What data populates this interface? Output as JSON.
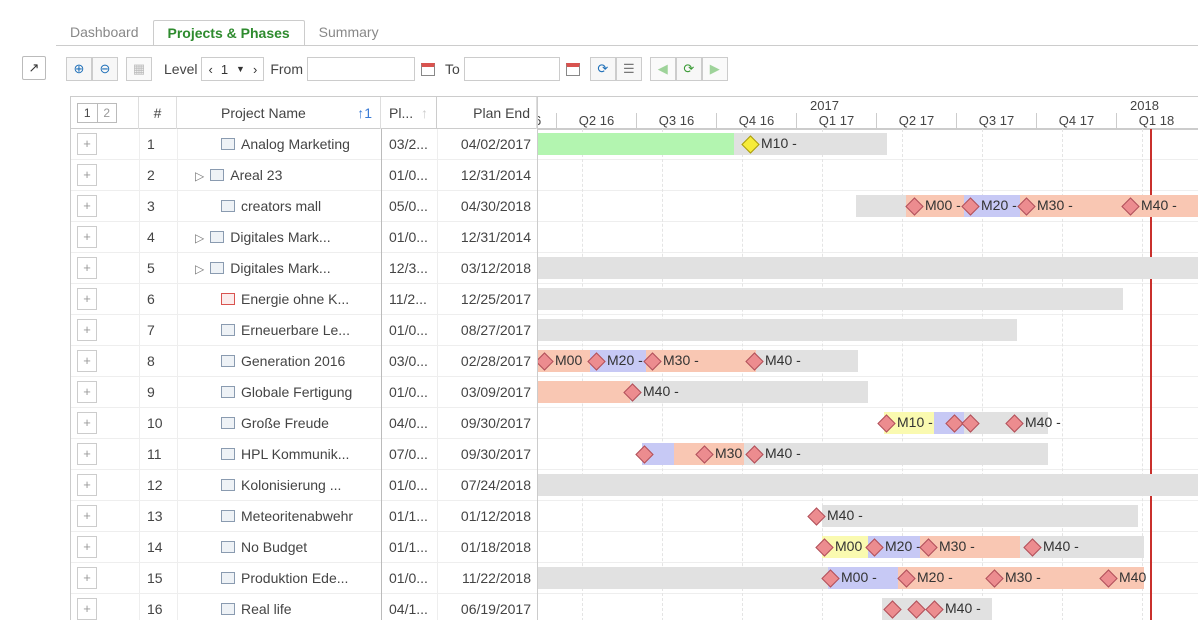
{
  "tabs": [
    "Dashboard",
    "Projects & Phases",
    "Summary"
  ],
  "toolbar": {
    "level_label": "Level",
    "level_value": "1",
    "from_label": "From",
    "to_label": "To",
    "from_value": "",
    "to_value": ""
  },
  "outline_levels": [
    "1",
    "2"
  ],
  "columns": {
    "num": "#",
    "name": "Project Name",
    "start": "Pl...",
    "end": "Plan End"
  },
  "timeline": {
    "years": [
      {
        "label": "2017"
      },
      {
        "label": "2018"
      }
    ],
    "quarters": [
      "Q2 16",
      "Q3 16",
      "Q4 16",
      "Q1 17",
      "Q2 17",
      "Q3 17",
      "Q4 17",
      "Q1 18"
    ],
    "partial_quarter": "6"
  },
  "rows": [
    {
      "num": "1",
      "name": "Analog Marketing",
      "start": "03/2...",
      "end": "04/02/2017",
      "expandable": false,
      "icon": "project-icon",
      "milestones_text": [
        "M10 -"
      ]
    },
    {
      "num": "2",
      "name": "Areal 23",
      "start": "01/0...",
      "end": "12/31/2014",
      "expandable": true,
      "icon": "project-icon",
      "milestones_text": []
    },
    {
      "num": "3",
      "name": "creators mall",
      "start": "05/0...",
      "end": "04/30/2018",
      "expandable": false,
      "icon": "project-icon",
      "milestones_text": [
        "M00 -",
        "M20 -",
        "M30 -",
        "M40 -"
      ]
    },
    {
      "num": "4",
      "name": "Digitales Mark...",
      "start": "01/0...",
      "end": "12/31/2014",
      "expandable": true,
      "icon": "project-icon",
      "milestones_text": []
    },
    {
      "num": "5",
      "name": "Digitales Mark...",
      "start": "12/3...",
      "end": "03/12/2018",
      "expandable": true,
      "icon": "project-icon",
      "milestones_text": []
    },
    {
      "num": "6",
      "name": "Energie ohne K...",
      "start": "11/2...",
      "end": "12/25/2017",
      "expandable": false,
      "icon": "project-icon-red",
      "milestones_text": []
    },
    {
      "num": "7",
      "name": "Erneuerbare Le...",
      "start": "01/0...",
      "end": "08/27/2017",
      "expandable": false,
      "icon": "project-icon",
      "milestones_text": []
    },
    {
      "num": "8",
      "name": "Generation 2016",
      "start": "03/0...",
      "end": "02/28/2017",
      "expandable": false,
      "icon": "project-icon",
      "milestones_text": [
        "M00 -",
        "M20 -",
        "M30 -",
        "M40 -"
      ]
    },
    {
      "num": "9",
      "name": "Globale Fertigung",
      "start": "01/0...",
      "end": "03/09/2017",
      "expandable": false,
      "icon": "project-icon",
      "milestones_text": [
        "M40 -"
      ]
    },
    {
      "num": "10",
      "name": "Große Freude",
      "start": "04/0...",
      "end": "09/30/2017",
      "expandable": false,
      "icon": "project-icon",
      "milestones_text": [
        "M10 -",
        "M40 -"
      ]
    },
    {
      "num": "11",
      "name": "HPL Kommunik...",
      "start": "07/0...",
      "end": "09/30/2017",
      "expandable": false,
      "icon": "project-icon",
      "milestones_text": [
        "M30 -",
        "M40 -"
      ]
    },
    {
      "num": "12",
      "name": "Kolonisierung ...",
      "start": "01/0...",
      "end": "07/24/2018",
      "expandable": false,
      "icon": "project-icon",
      "milestones_text": []
    },
    {
      "num": "13",
      "name": "Meteoritenabwehr",
      "start": "01/1...",
      "end": "01/12/2018",
      "expandable": false,
      "icon": "project-icon",
      "milestones_text": [
        "M40 -"
      ]
    },
    {
      "num": "14",
      "name": "No Budget",
      "start": "01/1...",
      "end": "01/18/2018",
      "expandable": false,
      "icon": "project-icon",
      "milestones_text": [
        "M00 -",
        "M20 -",
        "M30 -",
        "M40 -"
      ]
    },
    {
      "num": "15",
      "name": "Produktion Ede...",
      "start": "01/0...",
      "end": "11/22/2018",
      "expandable": false,
      "icon": "project-icon",
      "milestones_text": [
        "M00 -",
        "M20 -",
        "M30 -",
        "M40 -"
      ]
    },
    {
      "num": "16",
      "name": "Real life",
      "start": "04/1...",
      "end": "06/19/2017",
      "expandable": false,
      "icon": "project-icon",
      "milestones_text": [
        "M40 -"
      ]
    }
  ],
  "colors": {
    "bar_gray": "#e1e1e1",
    "phase_green": "#b3f5b0",
    "phase_blue": "#c7c9f5",
    "phase_salmon": "#f9c7b3",
    "phase_yellow": "#fafab0",
    "today_line": "#c9302c",
    "tab_active": "#2e8b2e"
  }
}
